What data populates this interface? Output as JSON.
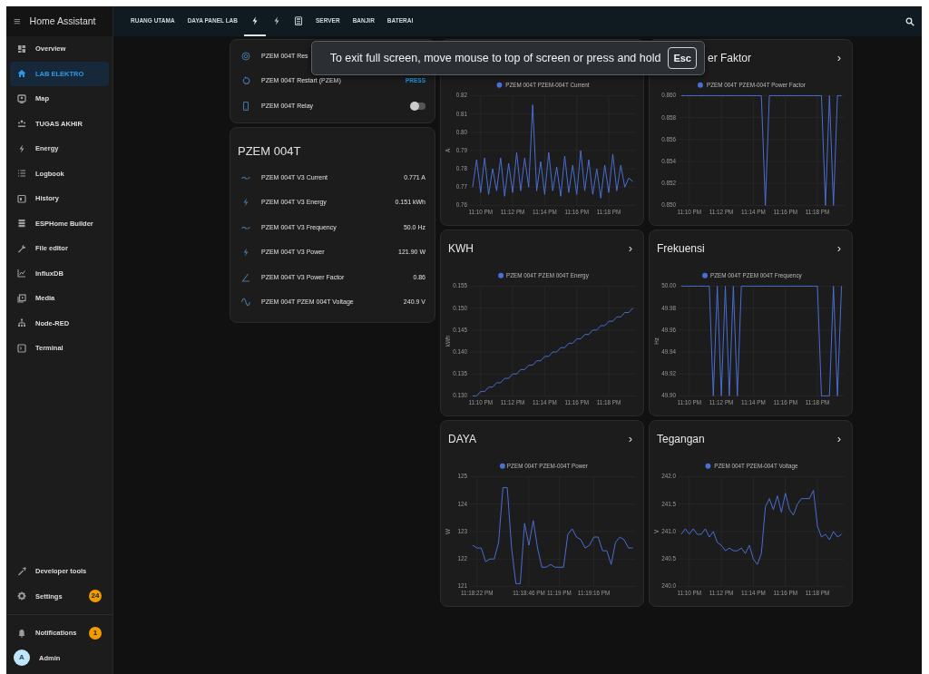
{
  "app": {
    "title": "Home Assistant",
    "menu_glyph": "≡"
  },
  "tabs": [
    {
      "kind": "text",
      "label": "RUANG UTAMA",
      "selected": false
    },
    {
      "kind": "text",
      "label": "DAYA PANEL LAB",
      "selected": false
    },
    {
      "kind": "icon",
      "selected": true
    },
    {
      "kind": "icon",
      "selected": false
    },
    {
      "kind": "icon",
      "selected": false
    },
    {
      "kind": "text",
      "label": "SERVER",
      "selected": false
    },
    {
      "kind": "text",
      "label": "BANJIR",
      "selected": false
    },
    {
      "kind": "text",
      "label": "BATERAI",
      "selected": false
    }
  ],
  "sidebar": {
    "items": [
      {
        "label": "Overview",
        "selected": false
      },
      {
        "label": "LAB ELEKTRO",
        "selected": true
      },
      {
        "label": "Map",
        "selected": false
      },
      {
        "label": "TUGAS AKHIR",
        "selected": false
      },
      {
        "label": "Energy",
        "selected": false
      },
      {
        "label": "Logbook",
        "selected": false
      },
      {
        "label": "History",
        "selected": false
      },
      {
        "label": "ESPHome Builder",
        "selected": false
      },
      {
        "label": "File editor",
        "selected": false
      },
      {
        "label": "InfluxDB",
        "selected": false
      },
      {
        "label": "Media",
        "selected": false
      },
      {
        "label": "Node-RED",
        "selected": false
      },
      {
        "label": "Terminal",
        "selected": false
      }
    ],
    "bottom_items": [
      {
        "label": "Developer tools"
      },
      {
        "label": "Settings",
        "badge": "24"
      }
    ],
    "notifications": {
      "label": "Notifications",
      "badge": "1"
    },
    "user": {
      "initial": "A",
      "name": "Admin"
    }
  },
  "toast": {
    "text": "To exit full screen, move mouse to top of screen or press and hold",
    "key": "Esc"
  },
  "controls_card": {
    "rows": [
      {
        "kind": "text",
        "name": "PZEM 004T Res"
      },
      {
        "kind": "button",
        "name": "PZEM 004T Restart (PZEM)",
        "action": "PRESS"
      },
      {
        "kind": "toggle",
        "name": "PZEM 004T Relay",
        "on": false
      }
    ]
  },
  "sensor_card": {
    "title": "PZEM 004T",
    "rows": [
      {
        "name": "PZEM 004T V3 Current",
        "value": "0.771 A"
      },
      {
        "name": "PZEM 004T V3 Energy",
        "value": "0.151 kWh"
      },
      {
        "name": "PZEM 004T V3 Frequency",
        "value": "50.0 Hz"
      },
      {
        "name": "PZEM 004T V3 Power",
        "value": "121.90 W"
      },
      {
        "name": "PZEM 004T V3 Power Factor",
        "value": "0.86"
      },
      {
        "name": "PZEM 004T PZEM 004T Voltage",
        "value": "240.9 V"
      }
    ]
  },
  "chart_cards": [
    {
      "chart_data": {
        "type": "line",
        "grid": true,
        "ylabel": "A",
        "ylim": [
          0.76,
          0.82
        ],
        "categories": [
          null,
          null,
          "11:10 PM",
          null,
          null,
          null,
          null,
          null,
          null,
          null,
          "11:12 PM",
          null,
          null,
          null,
          null,
          null,
          null,
          null,
          "11:14 PM",
          null,
          null,
          null,
          null,
          null,
          null,
          null,
          "11:16 PM",
          null,
          null,
          null,
          null,
          null,
          null,
          null,
          "11:18 PM",
          null,
          null,
          null,
          null,
          null,
          null
        ],
        "series": [
          {
            "name": "PZEM 004T PZEM-004T Current",
            "color": "#4a6fd8",
            "values": [
              0.77,
              0.785,
              0.767,
              0.786,
              0.766,
              0.78,
              0.768,
              0.786,
              0.765,
              0.783,
              0.767,
              0.789,
              0.768,
              0.786,
              0.77,
              0.815,
              0.768,
              0.784,
              0.766,
              0.789,
              0.768,
              0.781,
              0.765,
              0.787,
              0.767,
              0.782,
              0.766,
              0.79,
              0.768,
              0.785,
              0.766,
              0.78,
              0.764,
              0.782,
              0.767,
              0.788,
              0.768,
              0.782,
              0.77,
              0.775,
              0.773
            ]
          }
        ],
        "yticks": [
          {
            "value": 0.76,
            "label": "0.76"
          },
          {
            "value": 0.77,
            "label": "0.77"
          },
          {
            "value": 0.78,
            "label": "0.78"
          },
          {
            "value": 0.79,
            "label": "0.79"
          },
          {
            "value": 0.8,
            "label": "0.80"
          },
          {
            "value": 0.81,
            "label": "0.81"
          },
          {
            "value": 0.82,
            "label": "0.82"
          }
        ]
      }
    },
    {
      "title": "er Faktor",
      "chevron": "›",
      "chart_data": {
        "type": "line",
        "grid": true,
        "ylim": [
          0.85,
          0.86
        ],
        "categories": [
          null,
          null,
          "11:10 PM",
          null,
          null,
          null,
          null,
          null,
          null,
          null,
          "11:12 PM",
          null,
          null,
          null,
          null,
          null,
          null,
          null,
          "11:14 PM",
          null,
          null,
          null,
          null,
          null,
          null,
          null,
          "11:16 PM",
          null,
          null,
          null,
          null,
          null,
          null,
          null,
          "11:18 PM",
          null,
          null,
          null,
          null,
          null,
          null
        ],
        "series": [
          {
            "name": "PZEM 004T PZEM-004T Power Factor",
            "color": "#4a6fd8",
            "values": [
              0.86,
              0.86,
              0.86,
              0.86,
              0.86,
              0.86,
              0.86,
              0.86,
              0.86,
              0.86,
              0.86,
              0.86,
              0.86,
              0.86,
              0.86,
              0.86,
              0.86,
              0.86,
              0.86,
              0.86,
              0.86,
              0.85,
              0.86,
              0.86,
              0.86,
              0.86,
              0.86,
              0.86,
              0.86,
              0.86,
              0.86,
              0.86,
              0.86,
              0.86,
              0.86,
              0.86,
              0.85,
              0.86,
              0.85,
              0.86,
              0.86
            ]
          }
        ],
        "yticks": [
          {
            "value": 0.85,
            "label": "0.850"
          },
          {
            "value": 0.852,
            "label": "0.852"
          },
          {
            "value": 0.854,
            "label": "0.854"
          },
          {
            "value": 0.856,
            "label": "0.856"
          },
          {
            "value": 0.858,
            "label": "0.858"
          },
          {
            "value": 0.86,
            "label": "0.860"
          }
        ]
      }
    },
    {
      "title": "KWH",
      "chevron": "›",
      "chart_data": {
        "type": "line",
        "grid": true,
        "ylabel": "kWh",
        "ylim": [
          0.13,
          0.155
        ],
        "categories": [
          null,
          null,
          "11:10 PM",
          null,
          null,
          null,
          null,
          null,
          null,
          null,
          "11:12 PM",
          null,
          null,
          null,
          null,
          null,
          null,
          null,
          "11:14 PM",
          null,
          null,
          null,
          null,
          null,
          null,
          null,
          "11:16 PM",
          null,
          null,
          null,
          null,
          null,
          null,
          null,
          "11:18 PM",
          null,
          null,
          null,
          null,
          null,
          null
        ],
        "series": [
          {
            "name": "PZEM 004T PZEM 004T Energy",
            "color": "#4a6fd8",
            "values": [
              0.13,
              0.13,
              0.131,
              0.131,
              0.132,
              0.132,
              0.133,
              0.133,
              0.134,
              0.134,
              0.135,
              0.135,
              0.136,
              0.136,
              0.137,
              0.137,
              0.138,
              0.138,
              0.139,
              0.139,
              0.14,
              0.14,
              0.141,
              0.141,
              0.142,
              0.142,
              0.143,
              0.143,
              0.144,
              0.144,
              0.145,
              0.145,
              0.146,
              0.146,
              0.147,
              0.147,
              0.148,
              0.148,
              0.149,
              0.149,
              0.15
            ]
          }
        ],
        "yticks": [
          {
            "value": 0.13,
            "label": "0.130"
          },
          {
            "value": 0.135,
            "label": "0.135"
          },
          {
            "value": 0.14,
            "label": "0.140"
          },
          {
            "value": 0.145,
            "label": "0.145"
          },
          {
            "value": 0.15,
            "label": "0.150"
          },
          {
            "value": 0.155,
            "label": "0.155"
          }
        ]
      }
    },
    {
      "title": "Frekuensi",
      "chevron": "›",
      "chart_data": {
        "type": "line",
        "grid": true,
        "ylabel": "Hz",
        "ylim": [
          49.9,
          50.0
        ],
        "categories": [
          null,
          null,
          "11:10 PM",
          null,
          null,
          null,
          null,
          null,
          null,
          null,
          "11:12 PM",
          null,
          null,
          null,
          null,
          null,
          null,
          null,
          "11:14 PM",
          null,
          null,
          null,
          null,
          null,
          null,
          null,
          "11:16 PM",
          null,
          null,
          null,
          null,
          null,
          null,
          null,
          "11:18 PM",
          null,
          null,
          null,
          null,
          null,
          null
        ],
        "series": [
          {
            "name": "PZEM 004T PZEM 004T Frequency",
            "color": "#4a6fd8",
            "values": [
              50,
              50,
              50,
              50,
              50,
              50,
              50,
              50,
              49.9,
              50,
              49.9,
              50,
              49.9,
              50,
              49.9,
              50,
              50,
              50,
              50,
              50,
              50,
              50,
              50,
              50,
              50,
              50,
              50,
              50,
              50,
              50,
              50,
              50,
              50,
              50,
              50,
              49.9,
              49.9,
              49.9,
              50,
              49.9,
              50
            ]
          }
        ],
        "yticks": [
          {
            "value": 49.9,
            "label": "49.90"
          },
          {
            "value": 49.92,
            "label": "49.92"
          },
          {
            "value": 49.94,
            "label": "49.94"
          },
          {
            "value": 49.96,
            "label": "49.96"
          },
          {
            "value": 49.98,
            "label": "49.98"
          },
          {
            "value": 50.0,
            "label": "50.00"
          }
        ]
      }
    },
    {
      "title": "DAYA",
      "chevron": "›",
      "chart_data": {
        "type": "line",
        "grid": true,
        "ylabel": "W",
        "ylim": [
          121,
          125
        ],
        "categories": [
          null,
          "11:18:22 PM",
          null,
          null,
          null,
          null,
          null,
          null,
          null,
          null,
          null,
          null,
          null,
          "11:18:46 PM",
          null,
          null,
          null,
          null,
          null,
          null,
          "11:19 PM",
          null,
          null,
          null,
          null,
          null,
          null,
          null,
          "11:19:16 PM",
          null,
          null,
          null,
          null,
          null,
          null,
          null,
          null,
          null
        ],
        "series": [
          {
            "name": "PZEM 004T PZEM-004T Power",
            "color": "#4a6fd8",
            "values": [
              122.5,
              122.4,
              122.4,
              121.9,
              122.0,
              122.0,
              122.6,
              124.6,
              124.6,
              122.4,
              121.1,
              121.1,
              123.3,
              122.5,
              123.4,
              122.4,
              121.7,
              121.7,
              121.8,
              121.7,
              121.7,
              121.7,
              122.9,
              123.1,
              122.8,
              122.7,
              122.4,
              122.5,
              122.8,
              122.8,
              122.3,
              122.3,
              121.8,
              122.6,
              122.8,
              122.7,
              122.4,
              122.4
            ]
          }
        ],
        "yticks": [
          {
            "value": 121,
            "label": "121"
          },
          {
            "value": 122,
            "label": "122"
          },
          {
            "value": 123,
            "label": "123"
          },
          {
            "value": 124,
            "label": "124"
          },
          {
            "value": 125,
            "label": "125"
          }
        ]
      }
    },
    {
      "title": "Tegangan",
      "chevron": "›",
      "chart_data": {
        "type": "line",
        "grid": true,
        "ylabel": "V",
        "ylim": [
          240.0,
          242.0
        ],
        "categories": [
          null,
          null,
          "11:10 PM",
          null,
          null,
          null,
          null,
          null,
          null,
          null,
          "11:12 PM",
          null,
          null,
          null,
          null,
          null,
          null,
          null,
          "11:14 PM",
          null,
          null,
          null,
          null,
          null,
          null,
          null,
          "11:16 PM",
          null,
          null,
          null,
          null,
          null,
          null,
          null,
          "11:18 PM",
          null,
          null,
          null,
          null,
          null,
          null
        ],
        "series": [
          {
            "name": "PZEM 004T PZEM-004T Voltage",
            "color": "#4a6fd8",
            "values": [
              240.95,
              241.05,
              240.95,
              241.05,
              240.95,
              240.95,
              241.05,
              240.9,
              241.0,
              240.8,
              240.75,
              240.65,
              240.7,
              240.65,
              240.65,
              240.7,
              240.6,
              240.75,
              240.5,
              240.4,
              240.6,
              241.45,
              241.6,
              241.4,
              241.65,
              241.35,
              241.7,
              241.4,
              241.3,
              241.5,
              241.6,
              241.6,
              241.6,
              241.75,
              241.1,
              240.9,
              240.95,
              240.85,
              241.0,
              240.9,
              240.95
            ]
          }
        ],
        "yticks": [
          {
            "value": 240.0,
            "label": "240.0"
          },
          {
            "value": 240.5,
            "label": "240.5"
          },
          {
            "value": 241.0,
            "label": "241.0"
          },
          {
            "value": 241.5,
            "label": "241.5"
          },
          {
            "value": 242.0,
            "label": "242.0"
          }
        ]
      }
    }
  ]
}
